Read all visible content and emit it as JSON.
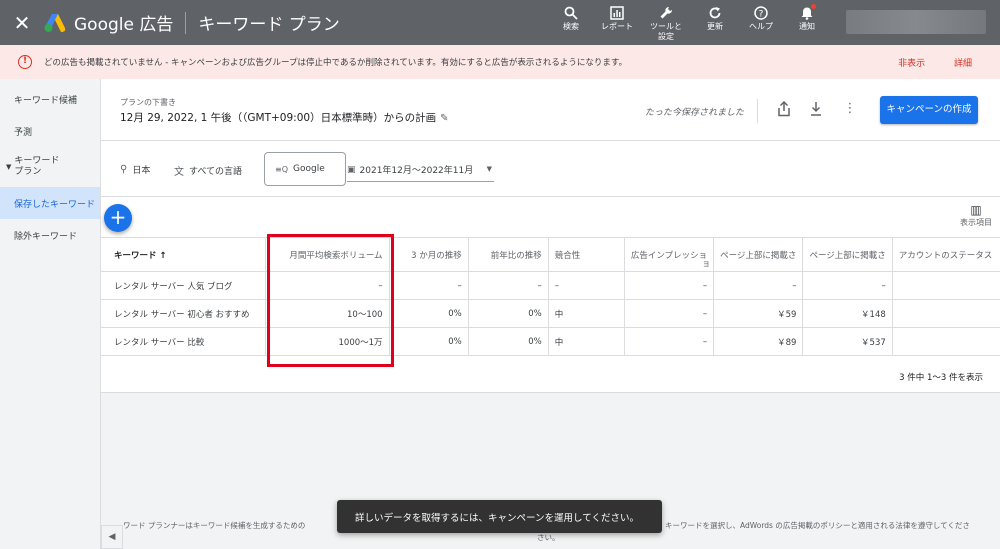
{
  "topbar": {
    "brand": "Google 広告",
    "page_title": "キーワード プラン",
    "tools": [
      {
        "label": "検索",
        "icon": "search-icon"
      },
      {
        "label": "レポート",
        "icon": "report-icon"
      },
      {
        "label": "ツールと\n設定",
        "icon": "wrench-icon"
      },
      {
        "label": "更新",
        "icon": "refresh-icon"
      },
      {
        "label": "ヘルプ",
        "icon": "help-icon"
      },
      {
        "label": "通知",
        "icon": "bell-icon"
      }
    ]
  },
  "alert": {
    "message": "どの広告も掲載されていません - キャンペーンおよび広告グループは停止中であるか削除されています。有効にすると広告が表示されるようになります。",
    "dismiss": "非表示",
    "details": "詳細"
  },
  "sidebar": {
    "items": [
      {
        "label": "キーワード候補"
      },
      {
        "label": "予測"
      },
      {
        "label": "キーワード\nプラン"
      },
      {
        "label": "保存したキーワード"
      },
      {
        "label": "除外キーワード"
      }
    ]
  },
  "plan": {
    "draft_label": "プランの下書き",
    "title": "12月 29, 2022, 1 午後（（GMT+09:00）日本標準時）からの計画",
    "saved_text": "たった今保存されました",
    "create_button": "キャンペーンの作成"
  },
  "filters": {
    "location": "日本",
    "language": "すべての言語",
    "network": "Google",
    "date_range": "2021年12月～2022年11月"
  },
  "table": {
    "columns_button": "表示項目",
    "headers": [
      "キーワード ↑",
      "月間平均検索ボリューム",
      "3 か月の推移",
      "前年比の推移",
      "競合性",
      "広告インプレッショ",
      "ページ上部に掲載さ",
      "ページ上部に掲載さ",
      "アカウントのステータス"
    ],
    "header_wrap": "ョ",
    "rows": [
      [
        "レンタル サーバー 人気 ブログ",
        "–",
        "–",
        "–",
        "–",
        "–",
        "–",
        "–",
        ""
      ],
      [
        "レンタル サーバー 初心者 おすすめ",
        "10～100",
        "0%",
        "0%",
        "中",
        "–",
        "￥59",
        "￥148",
        ""
      ],
      [
        "レンタル サーバー 比較",
        "1000～1万",
        "0%",
        "0%",
        "中",
        "–",
        "￥89",
        "￥537",
        ""
      ]
    ],
    "pager": "3 件中 1～3 件を表示"
  },
  "footer": {
    "left": "ワード プランナーはキーワード候補を生成するための",
    "right": "キーワードを選択し、AdWords の広告掲載のポリシーと適用される法律を遵守してくださ",
    "wrap": "さい。"
  },
  "toast": "詳しいデータを取得するには、キャンペーンを運用してください。",
  "colors": {
    "topbar": "#5f6368",
    "accent": "#1a73e8",
    "alert_bg": "#fce8e6",
    "highlight": "#e0001b"
  }
}
